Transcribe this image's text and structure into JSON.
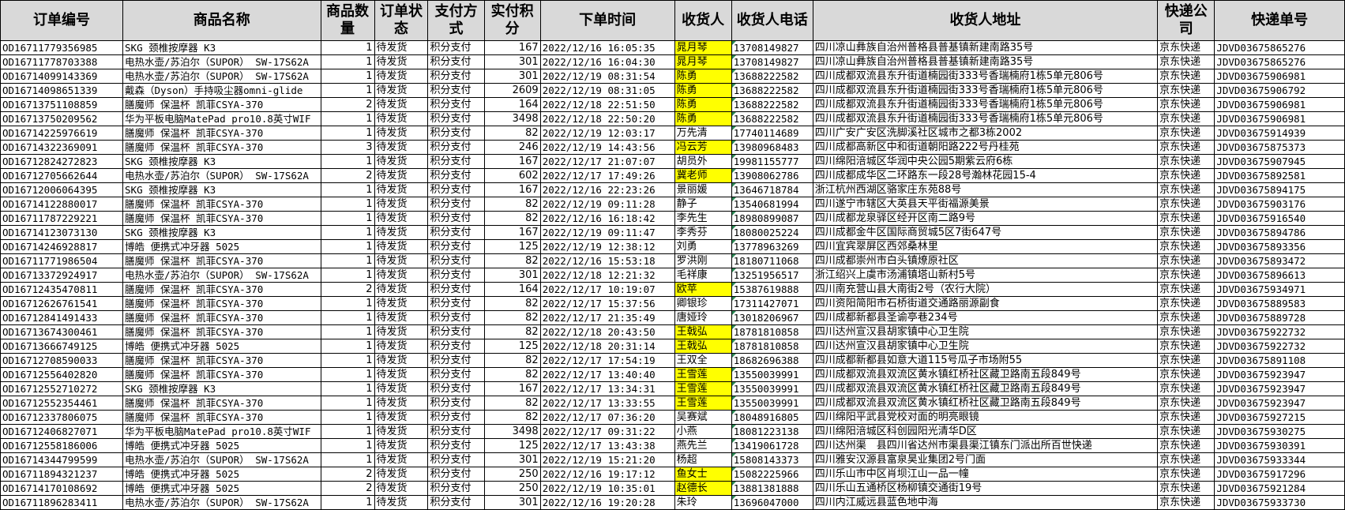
{
  "highlight_color": "#ffff00",
  "header_color": "#d9d9d9",
  "headers": [
    "订单编号",
    "商品名称",
    "商品数量",
    "订单状态",
    "支付方式",
    "实付积分",
    "下单时间",
    "收货人",
    "收货人电话",
    "收货人地址",
    "快递公司",
    "快递单号"
  ],
  "rows": [
    [
      "OD16711779356985",
      "SKG 颈椎按摩器 K3",
      "1",
      "待发货",
      "积分支付",
      "167",
      "2022/12/16 16:05:35",
      "晁月琴",
      "13708149827",
      "四川凉山彝族自治州普格县普基镇新建南路35号",
      "京东快递",
      "JDVD03675865276"
    ],
    [
      "OD16711778703388",
      "电热水壶/苏泊尔（SUPOR） SW-17S62A",
      "1",
      "待发货",
      "积分支付",
      "301",
      "2022/12/16 16:04:30",
      "晁月琴",
      "13708149827",
      "四川凉山彝族自治州普格县普基镇新建南路35号",
      "京东快递",
      "JDVD03675865276"
    ],
    [
      "OD16714099143369",
      "电热水壶/苏泊尔（SUPOR） SW-17S62A",
      "1",
      "待发货",
      "积分支付",
      "301",
      "2022/12/19 08:31:54",
      "陈勇",
      "13688222582",
      "四川成都双流县东升街道楠园街333号香瑞楠府1栋5单元806号",
      "京东快递",
      "JDVD03675906981"
    ],
    [
      "OD16714098651339",
      "戴森（Dyson）手持吸尘器omni-glide",
      "1",
      "待发货",
      "积分支付",
      "2609",
      "2022/12/19 08:31:05",
      "陈勇",
      "13688222582",
      "四川成都双流县东升街道楠园街333号香瑞楠府1栋5单元806号",
      "京东快递",
      "JDVD03675906792"
    ],
    [
      "OD16713751108859",
      "膳魔师 保温杯 凯菲CSYA-370",
      "2",
      "待发货",
      "积分支付",
      "164",
      "2022/12/18 22:51:50",
      "陈勇",
      "13688222582",
      "四川成都双流县东升街道楠园街333号香瑞楠府1栋5单元806号",
      "京东快递",
      "JDVD03675906981"
    ],
    [
      "OD16713750209562",
      "华为平板电脑MatePad pro10.8英寸WIF",
      "1",
      "待发货",
      "积分支付",
      "3498",
      "2022/12/18 22:50:20",
      "陈勇",
      "13688222582",
      "四川成都双流县东升街道楠园街333号香瑞楠府1栋5单元806号",
      "京东快递",
      "JDVD03675906981"
    ],
    [
      "OD16714225976619",
      "膳魔师 保温杯 凯菲CSYA-370",
      "1",
      "待发货",
      "积分支付",
      "82",
      "2022/12/19 12:03:17",
      "万先清",
      "17740114689",
      "四川广安广安区洗脚溪社区城市之都3栋2002",
      "京东快递",
      "JDVD03675914939"
    ],
    [
      "OD16714322369091",
      "膳魔师 保温杯 凯菲CSYA-370",
      "3",
      "待发货",
      "积分支付",
      "246",
      "2022/12/19 14:43:56",
      "冯云芳",
      "13980968483",
      "四川成都高新区中和街道朝阳路222号丹桂苑",
      "京东快递",
      "JDVD03675875373"
    ],
    [
      "OD16712824272823",
      "SKG 颈椎按摩器 K3",
      "1",
      "待发货",
      "积分支付",
      "167",
      "2022/12/17 21:07:07",
      "胡员外",
      "19981155777",
      "四川绵阳涪城区华润中央公园5期紫云府6栋",
      "京东快递",
      "JDVD03675907945"
    ],
    [
      "OD16712705662644",
      "电热水壶/苏泊尔（SUPOR） SW-17S62A",
      "2",
      "待发货",
      "积分支付",
      "602",
      "2022/12/17 17:49:26",
      "冀老师",
      "13908062786",
      "四川成都成华区二环路东一段28号瀚林花园15-4",
      "京东快递",
      "JDVD03675892581"
    ],
    [
      "OD16712006064395",
      "SKG 颈椎按摩器 K3",
      "1",
      "待发货",
      "积分支付",
      "167",
      "2022/12/16 22:23:26",
      "景丽媛",
      "13646718784",
      "浙江杭州西湖区骆家庄东苑88号",
      "京东快递",
      "JDVD03675894175"
    ],
    [
      "OD16714122880017",
      "膳魔师 保温杯 凯菲CSYA-370",
      "1",
      "待发货",
      "积分支付",
      "82",
      "2022/12/19 09:11:28",
      "静子",
      "13540681994",
      "四川遂宁市辖区大英县天平街福源美景",
      "京东快递",
      "JDVD03675903176"
    ],
    [
      "OD16711787229221",
      "膳魔师 保温杯 凯菲CSYA-370",
      "1",
      "待发货",
      "积分支付",
      "82",
      "2022/12/16 16:18:42",
      "李先生",
      "18980899087",
      "四川成都龙泉驿区经开区南二路9号",
      "京东快递",
      "JDVD03675916540"
    ],
    [
      "OD16714123073130",
      "SKG 颈椎按摩器 K3",
      "1",
      "待发货",
      "积分支付",
      "167",
      "2022/12/19 09:11:47",
      "李秀芬",
      "18080025224",
      "四川成都金牛区国际商贸城5区7街647号",
      "京东快递",
      "JDVD03675894786"
    ],
    [
      "OD16714246928817",
      "博皓 便携式冲牙器 5025",
      "1",
      "待发货",
      "积分支付",
      "125",
      "2022/12/19 12:38:12",
      "刘勇",
      "13778963269",
      "四川宜宾翠屏区西郊桑林里",
      "京东快递",
      "JDVD03675893356"
    ],
    [
      "OD16711771986504",
      "膳魔师 保温杯 凯菲CSYA-370",
      "1",
      "待发货",
      "积分支付",
      "82",
      "2022/12/16 15:53:18",
      "罗洪刚",
      "18180711068",
      "四川成都崇州市白头镇燎原社区",
      "京东快递",
      "JDVD03675893472"
    ],
    [
      "OD16713372924917",
      "电热水壶/苏泊尔（SUPOR） SW-17S62A",
      "1",
      "待发货",
      "积分支付",
      "301",
      "2022/12/18 12:21:32",
      "毛祥康",
      "13251956517",
      "浙江绍兴上虞市汤浦镇塔山新村5号",
      "京东快递",
      "JDVD03675896613"
    ],
    [
      "OD16712435470811",
      "膳魔师 保温杯 凯菲CSYA-370",
      "2",
      "待发货",
      "积分支付",
      "164",
      "2022/12/17 10:19:07",
      "欧苹",
      "15387619888",
      "四川南充营山县大南街2号（农行大院）",
      "京东快递",
      "JDVD03675934971"
    ],
    [
      "OD16712626761541",
      "膳魔师 保温杯 凯菲CSYA-370",
      "1",
      "待发货",
      "积分支付",
      "82",
      "2022/12/17 15:37:56",
      "卿银珍",
      "17311427071",
      "四川资阳简阳市石桥街道交通路丽源副食",
      "京东快递",
      "JDVD03675889583"
    ],
    [
      "OD16712841491433",
      "膳魔师 保温杯 凯菲CSYA-370",
      "1",
      "待发货",
      "积分支付",
      "82",
      "2022/12/17 21:35:49",
      "唐娅玲",
      "13018206967",
      "四川成都新都县圣谕亭巷234号",
      "京东快递",
      "JDVD03675889728"
    ],
    [
      "OD16713674300461",
      "膳魔师 保温杯 凯菲CSYA-370",
      "1",
      "待发货",
      "积分支付",
      "82",
      "2022/12/18 20:43:50",
      "王戟弘",
      "18781810858",
      "四川达州宣汉县胡家镇中心卫生院",
      "京东快递",
      "JDVD03675922732"
    ],
    [
      "OD16713666749125",
      "博皓 便携式冲牙器 5025",
      "1",
      "待发货",
      "积分支付",
      "125",
      "2022/12/18 20:31:14",
      "王戟弘",
      "18781810858",
      "四川达州宣汉县胡家镇中心卫生院",
      "京东快递",
      "JDVD03675922732"
    ],
    [
      "OD16712708590033",
      "膳魔师 保温杯 凯菲CSYA-370",
      "1",
      "待发货",
      "积分支付",
      "82",
      "2022/12/17 17:54:19",
      "王双全",
      "18682696388",
      "四川成都新都县如意大道115号瓜子市场附55",
      "京东快递",
      "JDVD03675891108"
    ],
    [
      "OD16712556402820",
      "膳魔师 保温杯 凯菲CSYA-370",
      "1",
      "待发货",
      "积分支付",
      "82",
      "2022/12/17 13:40:40",
      "王雪莲",
      "13550039991",
      "四川成都双流县双流区黄水镇红桥社区藏卫路南五段849号",
      "京东快递",
      "JDVD03675923947"
    ],
    [
      "OD16712552710272",
      "SKG 颈椎按摩器 K3",
      "1",
      "待发货",
      "积分支付",
      "167",
      "2022/12/17 13:34:31",
      "王雪莲",
      "13550039991",
      "四川成都双流县双流区黄水镇红桥社区藏卫路南五段849号",
      "京东快递",
      "JDVD03675923947"
    ],
    [
      "OD16712552354461",
      "膳魔师 保温杯 凯菲CSYA-370",
      "1",
      "待发货",
      "积分支付",
      "82",
      "2022/12/17 13:33:55",
      "王雪莲",
      "13550039991",
      "四川成都双流县双流区黄水镇红桥社区藏卫路南五段849号",
      "京东快递",
      "JDVD03675923947"
    ],
    [
      "OD16712337806075",
      "膳魔师 保温杯 凯菲CSYA-370",
      "1",
      "待发货",
      "积分支付",
      "82",
      "2022/12/17 07:36:20",
      "吴赛斌",
      "18048916805",
      "四川绵阳平武县党校对面的明亮眼镜",
      "京东快递",
      "JDVD03675927215"
    ],
    [
      "OD16712406827071",
      "华为平板电脑MatePad pro10.8英寸WIF",
      "1",
      "待发货",
      "积分支付",
      "3498",
      "2022/12/17 09:31:22",
      "小燕",
      "18081223138",
      "四川绵阳涪城区科创园阳光清华D区",
      "京东快递",
      "JDVD03675930275"
    ],
    [
      "OD16712558186006",
      "博皓 便携式冲牙器 5025",
      "1",
      "待发货",
      "积分支付",
      "125",
      "2022/12/17 13:43:38",
      "燕先兰",
      "13419061728",
      "四川达州渠　县四川省达州市渠县渠江镇东门派出所百世快递",
      "京东快递",
      "JDVD03675930391"
    ],
    [
      "OD16714344799599",
      "电热水壶/苏泊尔（SUPOR） SW-17S62A",
      "1",
      "待发货",
      "积分支付",
      "301",
      "2022/12/19 15:21:20",
      "杨超",
      "15808143373",
      "四川雅安汉源县富泉昊业集团2号门面",
      "京东快递",
      "JDVD03675933344"
    ],
    [
      "OD16711894321237",
      "博皓 便携式冲牙器 5025",
      "2",
      "待发货",
      "积分支付",
      "250",
      "2022/12/16 19:17:12",
      "鱼女士",
      "15082225966",
      "四川乐山市中区肖坝江山一品一幢",
      "京东快递",
      "JDVD03675917296"
    ],
    [
      "OD16714170108692",
      "博皓 便携式冲牙器 5025",
      "2",
      "待发货",
      "积分支付",
      "250",
      "2022/12/19 10:35:01",
      "赵德长",
      "13881381888",
      "四川乐山五通桥区杨柳镇交通街19号",
      "京东快递",
      "JDVD03675921284"
    ],
    [
      "OD16711896283411",
      "电热水壶/苏泊尔（SUPOR） SW-17S62A",
      "1",
      "待发货",
      "积分支付",
      "301",
      "2022/12/16 19:20:28",
      "朱玲",
      "13696047000",
      "四川内江威远县蓝色地中海",
      "京东快递",
      "JDVD03675933730"
    ]
  ],
  "highlighted_rows": [
    0,
    1,
    2,
    3,
    4,
    5,
    7,
    9,
    17,
    20,
    21,
    23,
    24,
    25,
    30,
    31
  ]
}
